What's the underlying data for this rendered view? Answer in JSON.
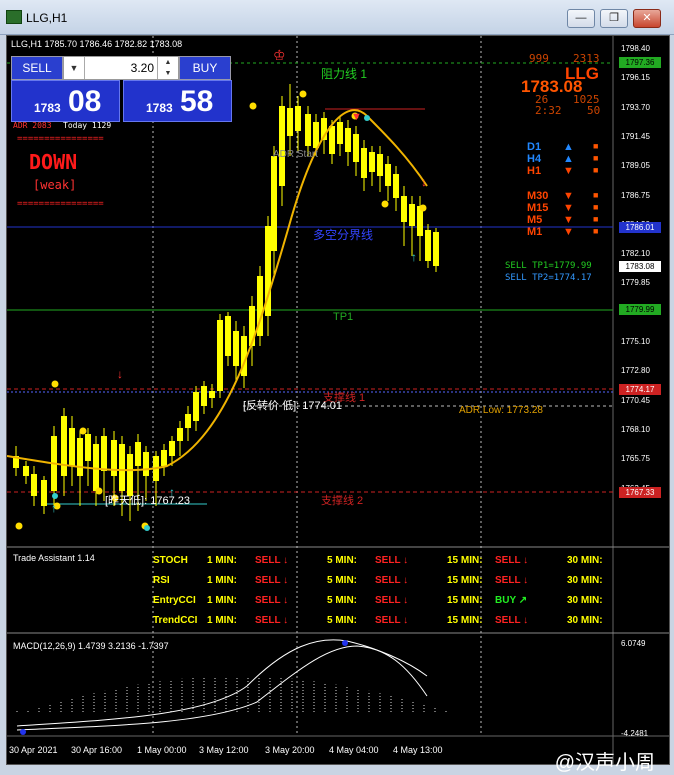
{
  "window": {
    "title": "LLG,H1",
    "min": "—",
    "restore": "❐",
    "close": "✕"
  },
  "ohlc": "LLG,H1  1785.70 1786.46 1782.82 1783.08",
  "trade_panel": {
    "sell": "SELL",
    "buy": "BUY",
    "volume": "3.20",
    "bid_small": "1783",
    "bid_big": "08",
    "ask_small": "1783",
    "ask_big": "58"
  },
  "indicator": {
    "adr": "ADR 2083",
    "today": "Today 1129",
    "signal": "DOWN",
    "strength": "[weak]",
    "dashes": "================",
    "adr_start": "ADR Start",
    "adr_low": "ADR Low: 1773.28"
  },
  "info": {
    "v1": "999",
    "v2": "2313",
    "symbol": "LLG",
    "price": "1783.08",
    "v3": "26",
    "v4": "1025",
    "time": "2:32",
    "v5": "50"
  },
  "timeframes": [
    {
      "tf": "D1",
      "dir": "▲",
      "c": "#2288ff"
    },
    {
      "tf": "H4",
      "dir": "▲",
      "c": "#2288ff"
    },
    {
      "tf": "H1",
      "dir": "▼",
      "c": "#ff4400"
    },
    {
      "tf": "M30",
      "dir": "▼",
      "c": "#ff4400"
    },
    {
      "tf": "M15",
      "dir": "▼",
      "c": "#ff4400"
    },
    {
      "tf": "M5",
      "dir": "▼",
      "c": "#ff4400"
    },
    {
      "tf": "M1",
      "dir": "▼",
      "c": "#ff4400"
    }
  ],
  "targets": {
    "tp1": "SELL TP1=1779.99",
    "tp2": "SELL TP2=1774.17"
  },
  "levels": {
    "resistance": "阻力线 1",
    "divider": "多空分界线",
    "tp1": "TP1",
    "support1": "支撑线 1",
    "support2": "支撑线 2",
    "reverse": "[反转价 低]: 1774.01",
    "prev_low": "[昨天低]: 1767.23"
  },
  "price_axis": [
    "1798.40",
    "1796.15",
    "1793.70",
    "1791.45",
    "1789.05",
    "1786.75",
    "1784.30",
    "1782.10",
    "1779.85",
    "1777.55",
    "1775.10",
    "1772.80",
    "1770.45",
    "1768.10",
    "1765.75",
    "1763.45"
  ],
  "price_tags": [
    {
      "v": "1797.36",
      "bg": "#22aa22",
      "fg": "#000"
    },
    {
      "v": "1786.01",
      "bg": "#2233cc",
      "fg": "#fff"
    },
    {
      "v": "1783.08",
      "bg": "#ffffff",
      "fg": "#000"
    },
    {
      "v": "1779.99",
      "bg": "#22aa22",
      "fg": "#000"
    },
    {
      "v": "1774.17",
      "bg": "#cc2222",
      "fg": "#fff"
    },
    {
      "v": "1767.33",
      "bg": "#cc2222",
      "fg": "#fff"
    }
  ],
  "trade_assistant": {
    "title": "Trade Assistant 1.14",
    "rows": [
      {
        "name": "STOCH",
        "c": [
          "SELL",
          "SELL",
          "SELL",
          "SELL"
        ]
      },
      {
        "name": "RSI",
        "c": [
          "SELL",
          "SELL",
          "SELL",
          "SELL"
        ]
      },
      {
        "name": "EntryCCI",
        "c": [
          "SELL",
          "SELL",
          "BUY",
          "SELL"
        ]
      },
      {
        "name": "TrendCCI",
        "c": [
          "SELL",
          "SELL",
          "SELL",
          "SELL"
        ]
      }
    ],
    "tfs": [
      "1 MIN:",
      "5 MIN:",
      "15 MIN:",
      "30 MIN:"
    ]
  },
  "macd": {
    "title": "MACD(12,26,9) 1.4739 3.2136 -1.7397",
    "top": "6.0749",
    "bottom": "-4.2481"
  },
  "x_axis": [
    "30 Apr 2021",
    "30 Apr 16:00",
    "1 May 00:00",
    "3 May 12:00",
    "3 May 20:00",
    "4 May 04:00",
    "4 May 13:00"
  ],
  "watermark": "@汉声小周"
}
